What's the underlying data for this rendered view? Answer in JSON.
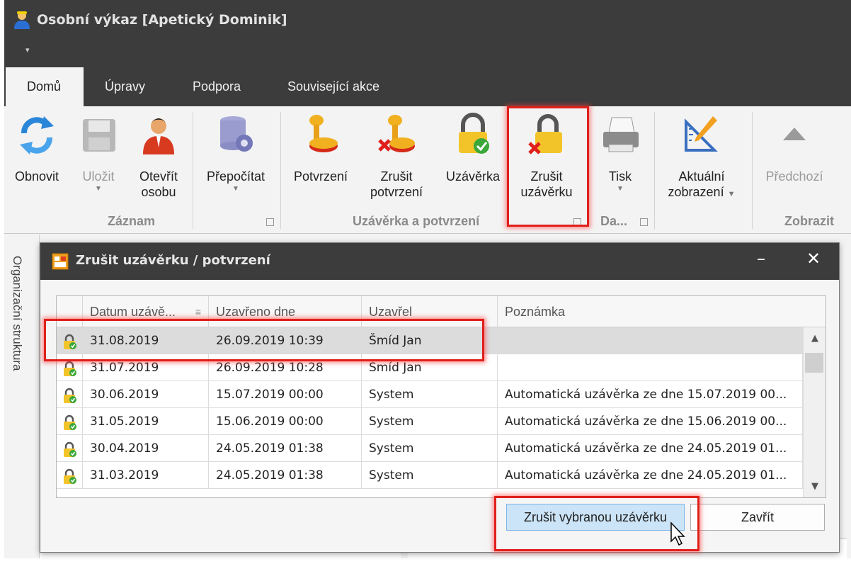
{
  "window": {
    "title": "Osobní výkaz [Apetický Dominik]",
    "qat_arrow": "▾"
  },
  "tabs": [
    {
      "label": "Domů",
      "active": true
    },
    {
      "label": "Úpravy"
    },
    {
      "label": "Podpora"
    },
    {
      "label": "Související akce"
    }
  ],
  "ribbon": {
    "groups": {
      "zaznam": "Záznam",
      "uzaverka": "Uzávěrka a potvrzení",
      "da": "Da...",
      "zobrazit": "Zobrazit"
    },
    "buttons": {
      "obnovit": {
        "line1": "Obnovit",
        "icon": "refresh-icon"
      },
      "ulozit": {
        "line1": "Uložit",
        "icon": "floppy-disk-icon"
      },
      "otevrit": {
        "line1": "Otevřít",
        "line2": "osobu",
        "icon": "person-icon"
      },
      "prepocitat": {
        "line1": "Přepočítat",
        "icon": "database-gear-icon"
      },
      "potvrzeni": {
        "line1": "Potvrzení",
        "icon": "stamp-icon"
      },
      "zrusit_potvrzeni": {
        "line1": "Zrušit",
        "line2": "potvrzení",
        "icon": "stamp-cancel-icon"
      },
      "uzaverka": {
        "line1": "Uzávěrka",
        "icon": "lock-check-icon"
      },
      "zrusit_uzaverku": {
        "line1": "Zrušit",
        "line2": "uzávěrku",
        "icon": "lock-cancel-icon"
      },
      "tisk": {
        "line1": "Tisk",
        "icon": "printer-icon"
      },
      "aktualni": {
        "line1": "Aktuální",
        "line2": "zobrazení",
        "icon": "ruler-pencil-icon"
      },
      "predchozi": {
        "line1": "Předchozí",
        "icon": "triangle-up-icon"
      }
    }
  },
  "side_panel": {
    "label": "Organizační struktura"
  },
  "dialog": {
    "title": "Zrušit uzávěrku / potvrzení",
    "minimize": "–",
    "close": "✕",
    "columns": [
      "Datum uzávě...",
      "Uzavřeno dne",
      "Uzavřel",
      "Poznámka"
    ],
    "rows": [
      {
        "datum": "31.08.2019",
        "uzavreno": "26.09.2019 10:39",
        "uzavrel": "Šmíd Jan",
        "poznamka": ""
      },
      {
        "datum": "31.07.2019",
        "uzavreno": "26.09.2019 10:28",
        "uzavrel": "Šmíd Jan",
        "poznamka": ""
      },
      {
        "datum": "30.06.2019",
        "uzavreno": "15.07.2019 00:00",
        "uzavrel": "System",
        "poznamka": "Automatická uzávěrka ze dne 15.07.2019 00..."
      },
      {
        "datum": "31.05.2019",
        "uzavreno": "15.06.2019 00:00",
        "uzavrel": "System",
        "poznamka": "Automatická uzávěrka ze dne 15.06.2019 00..."
      },
      {
        "datum": "30.04.2019",
        "uzavreno": "24.05.2019 01:38",
        "uzavrel": "System",
        "poznamka": "Automatická uzávěrka ze dne 24.05.2019 01..."
      },
      {
        "datum": "31.03.2019",
        "uzavreno": "24.05.2019 01:38",
        "uzavrel": "System",
        "poznamka": "Automatická uzávěrka ze dne 24.05.2019 01..."
      }
    ],
    "buttons": {
      "confirm": "Zrušit vybranou uzávěrku",
      "close": "Zavřít"
    }
  },
  "colors": {
    "titlebar": "#3c3c3c",
    "highlight": "#e0201c",
    "selected_row": "#dcdcdc",
    "primary_button": "#cce4f7"
  }
}
